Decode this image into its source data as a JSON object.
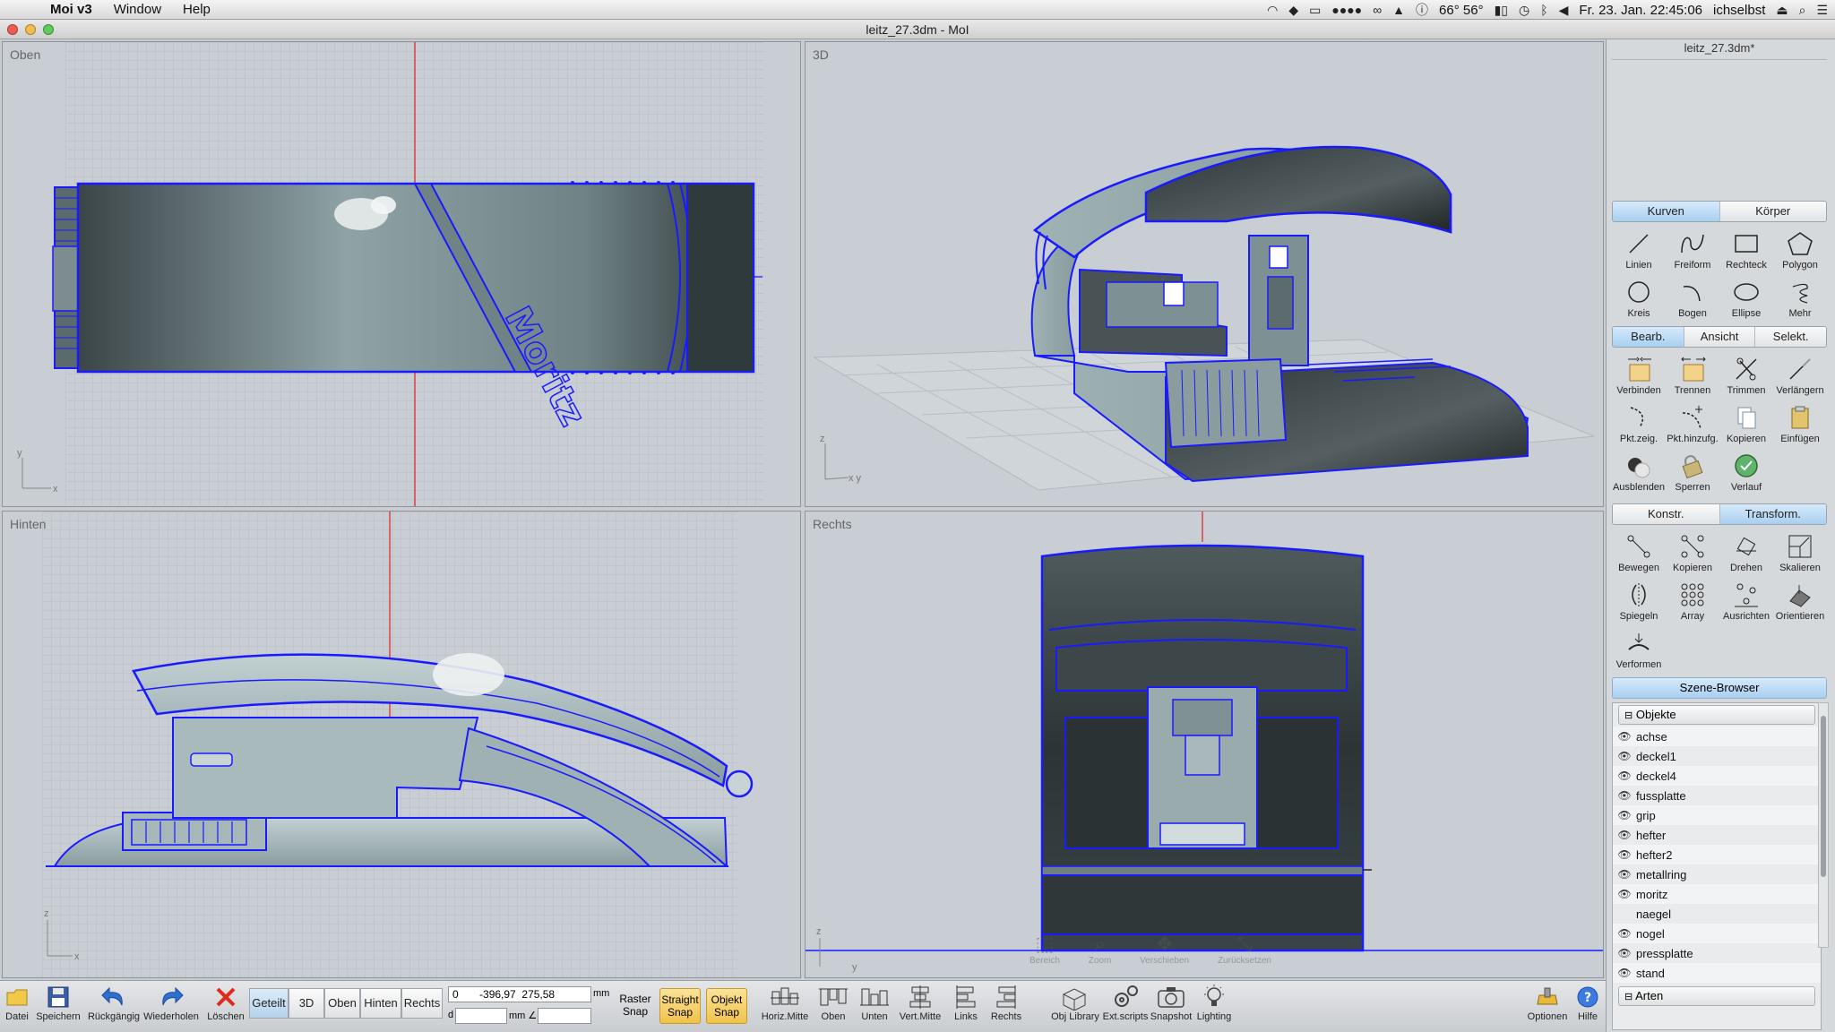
{
  "menubar": {
    "app": "Moi v3",
    "items": [
      "Window",
      "Help"
    ],
    "status": {
      "temp": "66° 56°",
      "datetime": "Fr. 23. Jan.  22:45:06",
      "user": "ichselbst"
    }
  },
  "window": {
    "title": "leitz_27.3dm - MoI"
  },
  "viewports": {
    "top": {
      "label": "Oben",
      "axis_v": "y",
      "axis_h": "x"
    },
    "perspective": {
      "label": "3D",
      "axis_v": "z",
      "axis_h": "x y"
    },
    "back": {
      "label": "Hinten",
      "axis_v": "z",
      "axis_h": "x"
    },
    "right": {
      "label": "Rechts",
      "axis_v": "z",
      "axis_h": "y"
    }
  },
  "model_text": "Moritz",
  "nav_overlay": {
    "items": [
      "Bereich",
      "Zoom",
      "Verschieben",
      "Zurücksetzen"
    ]
  },
  "panel": {
    "filename": "leitz_27.3dm*",
    "tabs1": [
      "Kurven",
      "Körper"
    ],
    "tools1": [
      "Linien",
      "Freiform",
      "Rechteck",
      "Polygon",
      "Kreis",
      "Bogen",
      "Ellipse",
      "Mehr"
    ],
    "tabs2": [
      "Bearb.",
      "Ansicht",
      "Selekt."
    ],
    "tools2": [
      "Verbinden",
      "Trennen",
      "Trimmen",
      "Verlängern",
      "Pkt.zeig.",
      "Pkt.hinzufg.",
      "Kopieren",
      "Einfügen",
      "Ausblenden",
      "Sperren",
      "Verlauf"
    ],
    "tabs3": [
      "Konstr.",
      "Transform."
    ],
    "tools3": [
      "Bewegen",
      "Kopieren",
      "Drehen",
      "Skalieren",
      "Spiegeln",
      "Array",
      "Ausrichten",
      "Orientieren",
      "Verformen"
    ],
    "scene_title": "Szene-Browser",
    "objects_group": "Objekte",
    "objects": [
      {
        "name": "achse",
        "visible": true
      },
      {
        "name": "deckel1",
        "visible": true
      },
      {
        "name": "deckel4",
        "visible": true
      },
      {
        "name": "fussplatte",
        "visible": true
      },
      {
        "name": "grip",
        "visible": true
      },
      {
        "name": "hefter",
        "visible": true
      },
      {
        "name": "hefter2",
        "visible": true
      },
      {
        "name": "metallring",
        "visible": true
      },
      {
        "name": "moritz",
        "visible": true
      },
      {
        "name": "naegel",
        "visible": false
      },
      {
        "name": "nogel",
        "visible": true
      },
      {
        "name": "pressplatte",
        "visible": true
      },
      {
        "name": "stand",
        "visible": true
      }
    ],
    "types_group": "Arten"
  },
  "bottombar": {
    "file_buttons": [
      "Datei",
      "Speichern",
      "Rückgängig",
      "Wiederholen",
      "Löschen"
    ],
    "view_buttons": [
      "Geteilt",
      "3D",
      "Oben",
      "Hinten",
      "Rechts"
    ],
    "coords": {
      "x": "0",
      "y": "-396,97",
      "z": "275,58",
      "unit": "mm",
      "d_label": "d",
      "angle_label": "mm ∠"
    },
    "snap_buttons": [
      "Raster Snap",
      "Straight Snap",
      "Objekt Snap"
    ],
    "view_tools": [
      "Horiz.Mitte",
      "Oben",
      "Unten",
      "Vert.Mitte",
      "Links",
      "Rechts"
    ],
    "extra_tools": [
      "Obj Library",
      "Ext.scripts",
      "Snapshot",
      "Lighting"
    ],
    "right_tools": [
      "Optionen",
      "Hilfe"
    ]
  },
  "colors": {
    "accent": "#1a1aff",
    "axis": "#e02020",
    "active_tab": "#a9cff0"
  }
}
